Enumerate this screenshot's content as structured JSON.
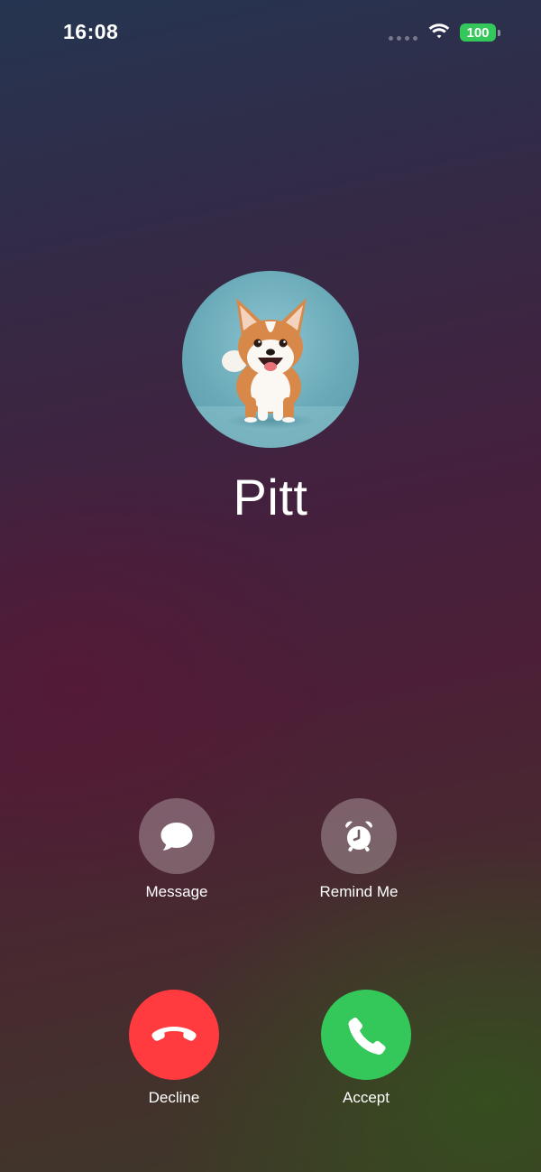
{
  "status_bar": {
    "time": "16:08",
    "battery_level": "100",
    "battery_color": "#34c759",
    "icons": [
      "cellular-signal-icon",
      "wifi-icon",
      "battery-icon"
    ]
  },
  "caller": {
    "name": "Pitt",
    "avatar": "corgi-photo"
  },
  "actions": {
    "message_label": "Message",
    "message_icon": "message-bubble-icon",
    "remind_label": "Remind Me",
    "remind_icon": "alarm-clock-icon",
    "decline_label": "Decline",
    "decline_icon": "phone-hangup-icon",
    "decline_color": "#ff3b3f",
    "accept_label": "Accept",
    "accept_icon": "phone-icon",
    "accept_color": "#34c759"
  }
}
